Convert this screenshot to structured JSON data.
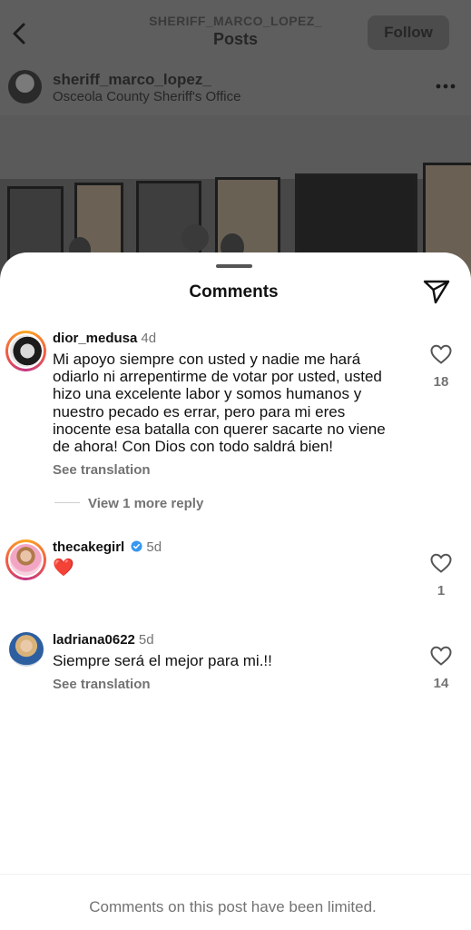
{
  "header": {
    "account": "SHERIFF_MARCO_LOPEZ_",
    "title": "Posts",
    "follow_label": "Follow"
  },
  "post": {
    "username": "sheriff_marco_lopez_",
    "location": "Osceola County Sheriff's Office"
  },
  "comments_sheet": {
    "title": "Comments",
    "comments": [
      {
        "username": "dior_medusa",
        "time": "4d",
        "text": "Mi apoyo siempre con usted y nadie me hará odiarlo ni arrepentirme de votar por usted, usted hizo una excelente labor y somos humanos y nuestro pecado es errar, pero para mi eres inocente esa batalla con querer sacarte no viene de ahora! Con Dios con todo saldrá bien!",
        "translate": "See translation",
        "likes": "18",
        "view_replies": "View 1 more reply"
      },
      {
        "username": "thecakegirl",
        "time": "5d",
        "text": "❤️",
        "likes": "1"
      },
      {
        "username": "ladriana0622",
        "time": "5d",
        "text": "Siempre será el mejor para mi.!!",
        "translate": "See translation",
        "likes": "14"
      }
    ],
    "footer_note": "Comments on this post have been limited."
  },
  "icons": {
    "back": "chevron-left-icon",
    "more": "more-horizontal-icon",
    "share": "paper-plane-icon",
    "like": "heart-outline-icon",
    "verified": "verified-badge-icon"
  },
  "colors": {
    "verified_blue": "#3897f0",
    "muted_text": "#737373",
    "heart_red": "#e0245e"
  }
}
